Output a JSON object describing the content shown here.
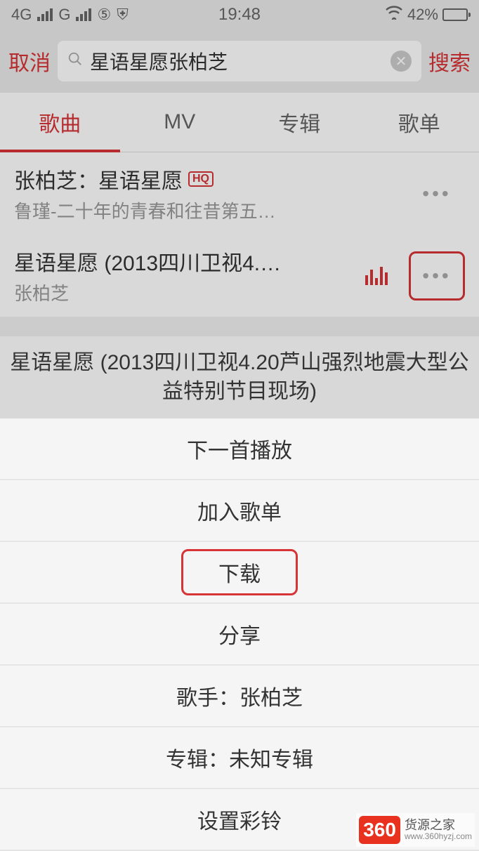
{
  "status": {
    "net1": "4G",
    "net2": "G",
    "time": "19:48",
    "battery_pct": "42%"
  },
  "header": {
    "cancel": "取消",
    "search_value": "星语星愿张柏芝",
    "search": "搜索"
  },
  "tabs": [
    "歌曲",
    "MV",
    "专辑",
    "歌单"
  ],
  "results": [
    {
      "title": "张柏芝：星语星愿",
      "hq": "HQ",
      "sub": "鲁瑾-二十年的青春和往昔第五…"
    },
    {
      "title": "星语星愿 (2013四川卫视4.…",
      "sub": "张柏芝"
    }
  ],
  "sheet": {
    "title": "星语星愿 (2013四川卫视4.20芦山强烈地震大型公益特别节目现场)",
    "items": {
      "play_next": "下一首播放",
      "add_playlist": "加入歌单",
      "download": "下载",
      "share": "分享",
      "artist": "歌手：张柏芝",
      "album": "专辑：未知专辑",
      "ringtone": "设置彩铃"
    }
  },
  "watermark": {
    "badge": "360",
    "text1": "货源之家",
    "text2": "www.360hyzj.com"
  }
}
